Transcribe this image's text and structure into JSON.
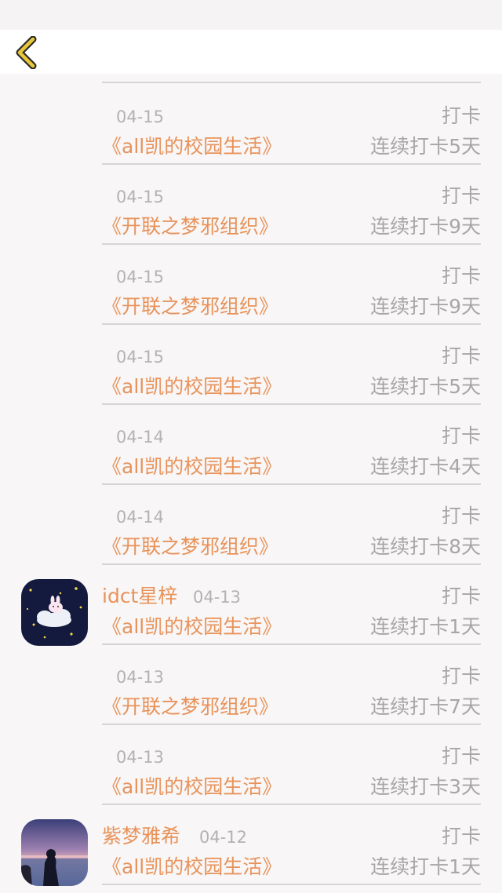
{
  "header": {
    "back_icon": "chevron-left-icon",
    "accent_color": "#e8b830"
  },
  "rows": [
    {
      "date": "04-15",
      "action": "打卡",
      "book": "《all凯的校园生活》",
      "streak": "连续打卡5天"
    },
    {
      "date": "04-15",
      "action": "打卡",
      "book": "《开联之梦邪组织》",
      "streak": "连续打卡9天"
    },
    {
      "date": "04-15",
      "action": "打卡",
      "book": "《开联之梦邪组织》",
      "streak": "连续打卡9天"
    },
    {
      "date": "04-15",
      "action": "打卡",
      "book": "《all凯的校园生活》",
      "streak": "连续打卡5天"
    },
    {
      "date": "04-14",
      "action": "打卡",
      "book": "《all凯的校园生活》",
      "streak": "连续打卡4天"
    },
    {
      "date": "04-14",
      "action": "打卡",
      "book": "《开联之梦邪组织》",
      "streak": "连续打卡8天"
    },
    {
      "user": "idct星梓",
      "date": "04-13",
      "action": "打卡",
      "book": "《all凯的校园生活》",
      "streak": "连续打卡1天"
    },
    {
      "date": "04-13",
      "action": "打卡",
      "book": "《开联之梦邪组织》",
      "streak": "连续打卡7天"
    },
    {
      "date": "04-13",
      "action": "打卡",
      "book": "《all凯的校园生活》",
      "streak": "连续打卡3天"
    },
    {
      "user": "紫梦雅希",
      "date": "04-12",
      "action": "打卡",
      "book": "《all凯的校园生活》",
      "streak": "连续打卡1天"
    }
  ],
  "colors": {
    "book_title": "#e8935a",
    "username": "#e8935a",
    "muted_text": "#a8a6a7",
    "date_text": "#b3b1b2",
    "divider": "#d6d4d5"
  }
}
